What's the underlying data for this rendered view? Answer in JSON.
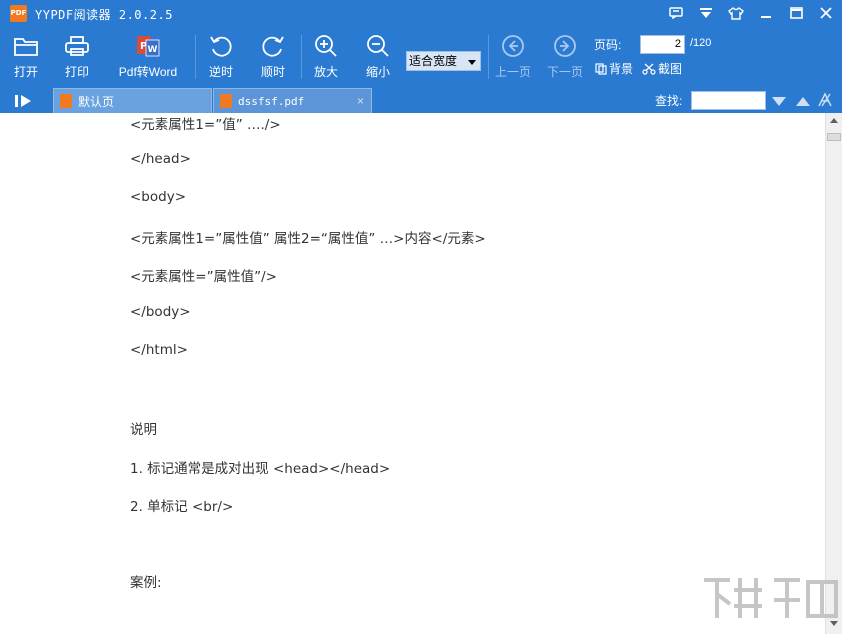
{
  "window": {
    "logo_text": "PDF",
    "title": "YYPDF阅读器 2.0.2.5"
  },
  "toolbar": {
    "open": "打开",
    "print": "打印",
    "pdf_to_word": "Pdf转Word",
    "rotate_left": "逆时",
    "rotate_right": "顺时",
    "zoom_in": "放大",
    "zoom_out": "缩小",
    "zoom_mode": "适合宽度",
    "prev_page": "上一页",
    "next_page": "下一页",
    "page_label": "页码:",
    "current_page": "2",
    "total_pages": "/120",
    "background": "背景",
    "screenshot": "截图"
  },
  "tabs": [
    {
      "label": "默认页"
    },
    {
      "label": "dssfsf.pdf",
      "close": "×"
    }
  ],
  "search": {
    "label": "查找:",
    "value": ""
  },
  "document": {
    "lines": [
      "<元素属性1=”值” …./>",
      "</head>",
      "<body>",
      "<元素属性1=”属性值” 属性2=“属性值” …>内容</元素>",
      "<元素属性=”属性值”/>",
      "</body>",
      "</html>",
      "说明",
      "1. 标记通常是成对出现 <head></head>",
      "2. 单标记 <br/>",
      "案例:"
    ]
  },
  "colors": {
    "chrome": "#2a7ad2",
    "accent": "#f07a22"
  }
}
